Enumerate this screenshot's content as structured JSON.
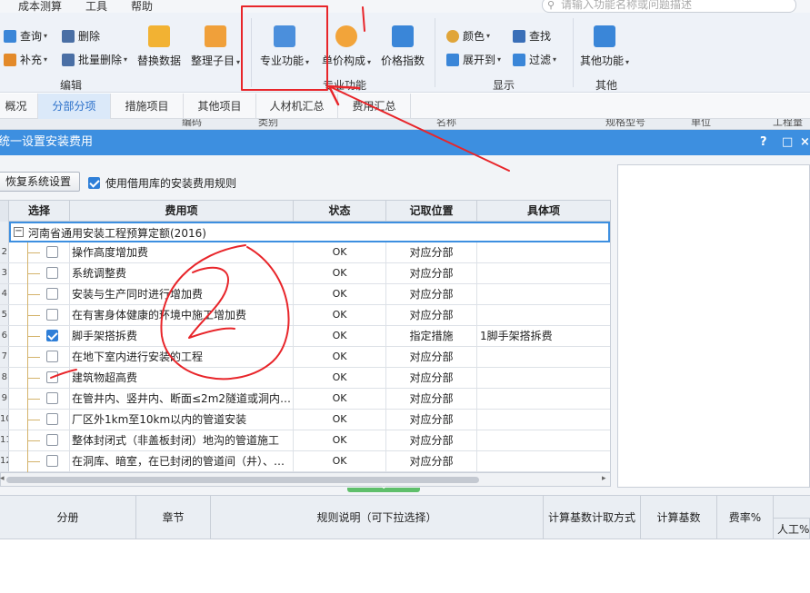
{
  "menu": {
    "items": [
      "成本测算",
      "工具",
      "帮助"
    ],
    "search_placeholder": "请输入功能名称或问题描述"
  },
  "ribbon": {
    "edit_group": {
      "label": "编辑",
      "query": "查询",
      "delete": "删除",
      "supplement": "补充",
      "batch_delete": "批量删除",
      "replace_data": "替换数据",
      "organize_items": "整理子目"
    },
    "pro_group": {
      "label": "专业功能",
      "pro_function": "专业功能",
      "unit_price": "单价构成",
      "price_index": "价格指数"
    },
    "display_group": {
      "label": "显示",
      "color": "颜色",
      "find": "查找",
      "expand_to": "展开到",
      "filter": "过滤"
    },
    "other_group": {
      "label": "其他",
      "other_function": "其他功能"
    }
  },
  "tabs": [
    "概况",
    "分部分项",
    "措施项目",
    "其他项目",
    "人材机汇总",
    "费用汇总"
  ],
  "active_tab": "分部分项",
  "behind_headers": [
    "编码",
    "类别",
    "名称",
    "规格型号",
    "单位",
    "工程量"
  ],
  "dialog": {
    "title": "统一设置安装费用",
    "help": "?",
    "maximize": "□",
    "close": "×",
    "restore_button": "恢复系统设置",
    "use_library_label": "使用借用库的安装费用规则",
    "use_library_checked": true
  },
  "grid": {
    "headers": [
      "选择",
      "费用项",
      "状态",
      "记取位置",
      "具体项"
    ],
    "group": "河南省通用安装工程预算定额(2016)",
    "rows": [
      {
        "num": "2",
        "checked": false,
        "item": "操作高度增加费",
        "status": "OK",
        "position": "对应分部",
        "detail": ""
      },
      {
        "num": "3",
        "checked": false,
        "item": "系统调整费",
        "status": "OK",
        "position": "对应分部",
        "detail": ""
      },
      {
        "num": "4",
        "checked": false,
        "item": "安装与生产同时进行增加费",
        "status": "OK",
        "position": "对应分部",
        "detail": ""
      },
      {
        "num": "5",
        "checked": false,
        "item": "在有害身体健康的环境中施工增加费",
        "status": "OK",
        "position": "对应分部",
        "detail": ""
      },
      {
        "num": "6",
        "checked": true,
        "item": "脚手架搭拆费",
        "status": "OK",
        "position": "指定措施",
        "detail": "1脚手架搭拆费"
      },
      {
        "num": "7",
        "checked": false,
        "item": "在地下室内进行安装的工程",
        "status": "OK",
        "position": "对应分部",
        "detail": ""
      },
      {
        "num": "8",
        "checked": false,
        "item": "建筑物超高费",
        "status": "OK",
        "position": "对应分部",
        "detail": ""
      },
      {
        "num": "9",
        "checked": false,
        "item": "在管井内、竖井内、断面≤2m2隧道或洞内…",
        "status": "OK",
        "position": "对应分部",
        "detail": ""
      },
      {
        "num": "10",
        "checked": false,
        "item": "厂区外1km至10km以内的管道安装",
        "status": "OK",
        "position": "对应分部",
        "detail": ""
      },
      {
        "num": "11",
        "checked": false,
        "item": "整体封闭式（非盖板封闭）地沟的管道施工",
        "status": "OK",
        "position": "对应分部",
        "detail": ""
      },
      {
        "num": "12",
        "checked": false,
        "item": "在洞库、暗室，在已封闭的管道间（井）、…",
        "status": "OK",
        "position": "对应分部",
        "detail": ""
      }
    ]
  },
  "bottom_table": {
    "headers": [
      "分册",
      "章节",
      "规则说明（可下拉选择）",
      "计算基数计取方式",
      "计算基数",
      "费率%"
    ],
    "sub_header": "人工%"
  },
  "annotations": {
    "mark1": "1",
    "mark2": "2",
    "color": "#e8252a"
  }
}
